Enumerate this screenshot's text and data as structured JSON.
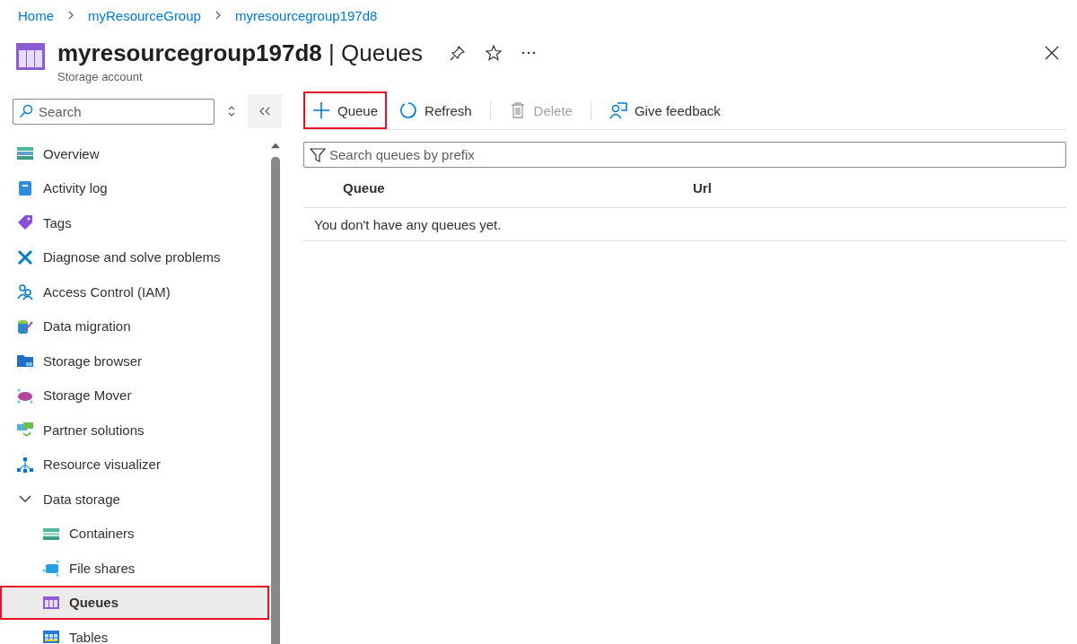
{
  "breadcrumb": [
    "Home",
    "myResourceGroup",
    "myresourcegroup197d8"
  ],
  "header": {
    "title": "**myresourcegroup197d8** | Queues",
    "subtitle": "Storage account"
  },
  "sidebar": {
    "search": {
      "placeholder": "Search"
    },
    "items": [
      {
        "label": "Overview",
        "selected": false,
        "highlighted": false
      },
      {
        "label": "Activity log",
        "selected": false,
        "highlighted": false
      },
      {
        "label": "Tags",
        "selected": false,
        "highlighted": false
      },
      {
        "label": "Diagnose and solve problems",
        "selected": false,
        "highlighted": false
      },
      {
        "label": "Access Control (IAM)",
        "selected": false,
        "highlighted": false
      },
      {
        "label": "Data migration",
        "selected": false,
        "highlighted": false
      },
      {
        "label": "Storage browser",
        "selected": false,
        "highlighted": false
      },
      {
        "label": "Storage Mover",
        "selected": false,
        "highlighted": false
      },
      {
        "label": "Partner solutions",
        "selected": false,
        "highlighted": false
      },
      {
        "label": "Resource visualizer",
        "selected": false,
        "highlighted": false
      },
      {
        "label": "Data storage",
        "selected": false,
        "highlighted": false,
        "expanded": true,
        "children": [
          {
            "label": "Containers",
            "selected": false,
            "highlighted": false
          },
          {
            "label": "File shares",
            "selected": false,
            "highlighted": false
          },
          {
            "label": "Queues",
            "selected": true,
            "highlighted": true
          },
          {
            "label": "Tables",
            "selected": false,
            "highlighted": false
          }
        ]
      }
    ]
  },
  "toolbar": [
    {
      "label": "Queue",
      "disabled": false,
      "highlighted": true
    },
    {
      "label": "Refresh",
      "disabled": false,
      "highlighted": false
    },
    {
      "label": "Delete",
      "disabled": true,
      "highlighted": false
    },
    {
      "label": "Give feedback",
      "disabled": false,
      "highlighted": false
    }
  ],
  "filter": {
    "placeholder": "Search queues by prefix"
  },
  "table": {
    "columns": [
      "Queue",
      "Url"
    ],
    "empty_message": "You don't have any queues yet."
  }
}
